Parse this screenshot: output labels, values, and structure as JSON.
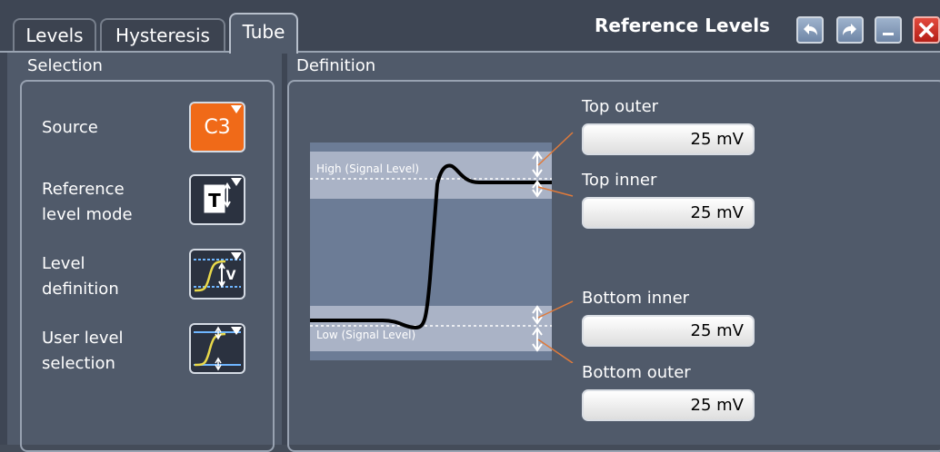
{
  "tabs": [
    {
      "label": "Levels"
    },
    {
      "label": "Hysteresis"
    },
    {
      "label": "Tube",
      "active": true
    }
  ],
  "window": {
    "title": "Reference Levels"
  },
  "selection": {
    "label": "Selection",
    "source_label": "Source",
    "source_value": "C3",
    "ref_mode_label_1": "Reference",
    "ref_mode_label_2": "level mode",
    "level_def_label_1": "Level",
    "level_def_label_2": "definition",
    "user_level_label_1": "User level",
    "user_level_label_2": "selection"
  },
  "definition": {
    "label": "Definition",
    "diagram": {
      "high_label": "High (Signal Level)",
      "low_label": "Low (Signal Level)"
    },
    "fields": {
      "top_outer": {
        "label": "Top outer",
        "value": "25 mV"
      },
      "top_inner": {
        "label": "Top inner",
        "value": "25 mV"
      },
      "bottom_inner": {
        "label": "Bottom inner",
        "value": "25 mV"
      },
      "bottom_outer": {
        "label": "Bottom outer",
        "value": "25 mV"
      }
    }
  },
  "colors": {
    "source_accent": "#f06a18",
    "close_button": "#d12a20",
    "leader_line": "#e07a3a"
  },
  "icons": {
    "undo": "undo-arrow-icon",
    "redo": "redo-arrow-icon",
    "minimize": "minimize-icon",
    "close": "close-x-icon",
    "ref_mode": "reference-level-mode-icon",
    "level_def": "level-definition-icon",
    "user_level": "user-level-selection-icon"
  }
}
